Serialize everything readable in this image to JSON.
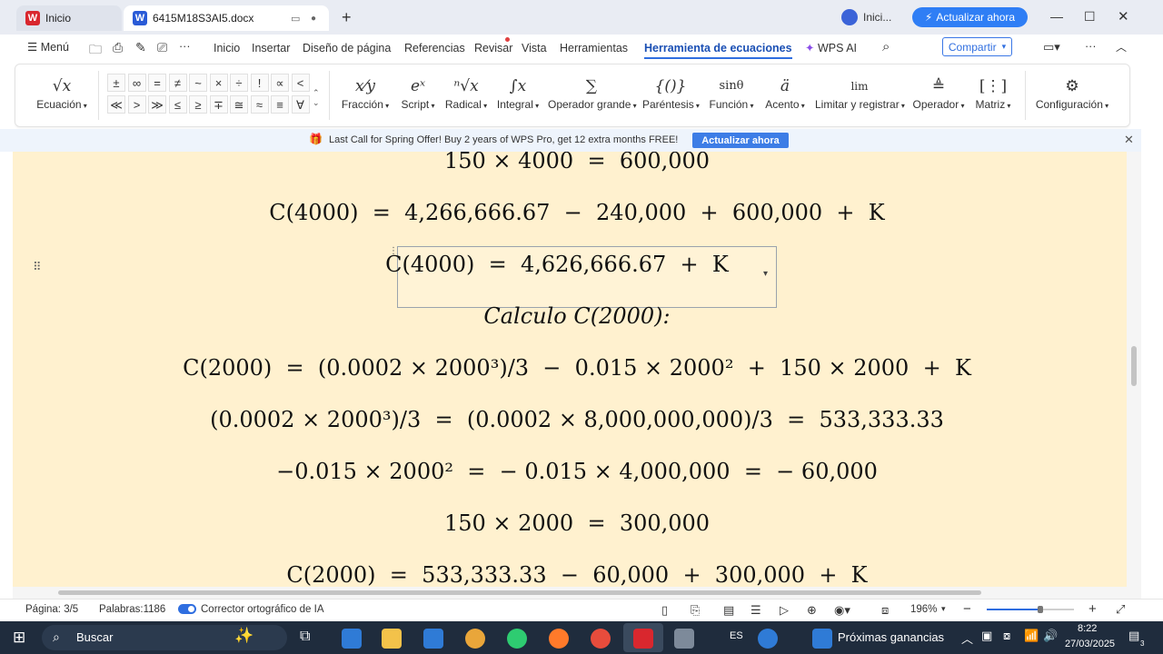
{
  "titlebar": {
    "tab_home": "Inicio",
    "tab_doc": "6415M18S3AI5.docx",
    "user_label": "Inici...",
    "upgrade_label": "Actualizar ahora"
  },
  "menu": {
    "menu_label": "Menú",
    "items": [
      "Inicio",
      "Insertar",
      "Diseño de página",
      "Referencias",
      "Revisar",
      "Vista",
      "Herramientas",
      "Herramienta de ecuaciones"
    ],
    "wps_ai": "WPS AI",
    "share": "Compartir"
  },
  "ribbon": {
    "equation": "Ecuación",
    "symbols_row1": [
      "±",
      "∞",
      "=",
      "≠",
      "~",
      "×",
      "÷",
      "!",
      "∝",
      "<"
    ],
    "symbols_row2": [
      "≪",
      ">",
      "≫",
      "≤",
      "≥",
      "∓",
      "≅",
      "≈",
      "≡",
      "∀"
    ],
    "tools": [
      "Fracción",
      "Script",
      "Radical",
      "Integral",
      "Operador grande",
      "Paréntesis",
      "Función",
      "Acento",
      "Limitar y registrar",
      "Operador",
      "Matriz"
    ],
    "settings": "Configuración"
  },
  "banner": {
    "text": "Last Call for Spring Offer! Buy 2 years of WPS Pro, get 12 extra months FREE!",
    "button": "Actualizar ahora"
  },
  "document": {
    "line1": "150 × 4000  =  600,000",
    "line2": "C(4000)  =  4,266,666.67  −  240,000  +  600,000  +  K",
    "line3": "C(4000)  =  4,626,666.67  +  K",
    "line4": "Calculo C(2000):",
    "line5": "C(2000)  =  (0.0002 × 2000³)/3  −  0.015 × 2000²  +  150 × 2000  +  K",
    "line6": "(0.0002 × 2000³)/3  =  (0.0002 × 8,000,000,000)/3  =  533,333.33",
    "line7": "−0.015 × 2000²  =  − 0.015 × 4,000,000  =  − 60,000",
    "line8": "150 × 2000  =  300,000",
    "line9": "C(2000)  =  533,333.33  −  60,000  +  300,000  +  K"
  },
  "status": {
    "page": "Página: 3/5",
    "words": "Palabras:1186",
    "spell": "Corrector ortográfico de IA",
    "zoom": "196%"
  },
  "taskbar": {
    "search": "Buscar",
    "weather": "Próximas ganancias",
    "lang": "ES",
    "time": "8:22",
    "date": "27/03/2025",
    "notifications": "3"
  },
  "colors": {
    "accent": "#2f7ef5",
    "doc_bg": "#fff1cf",
    "taskbar": "#1f2c3d"
  }
}
